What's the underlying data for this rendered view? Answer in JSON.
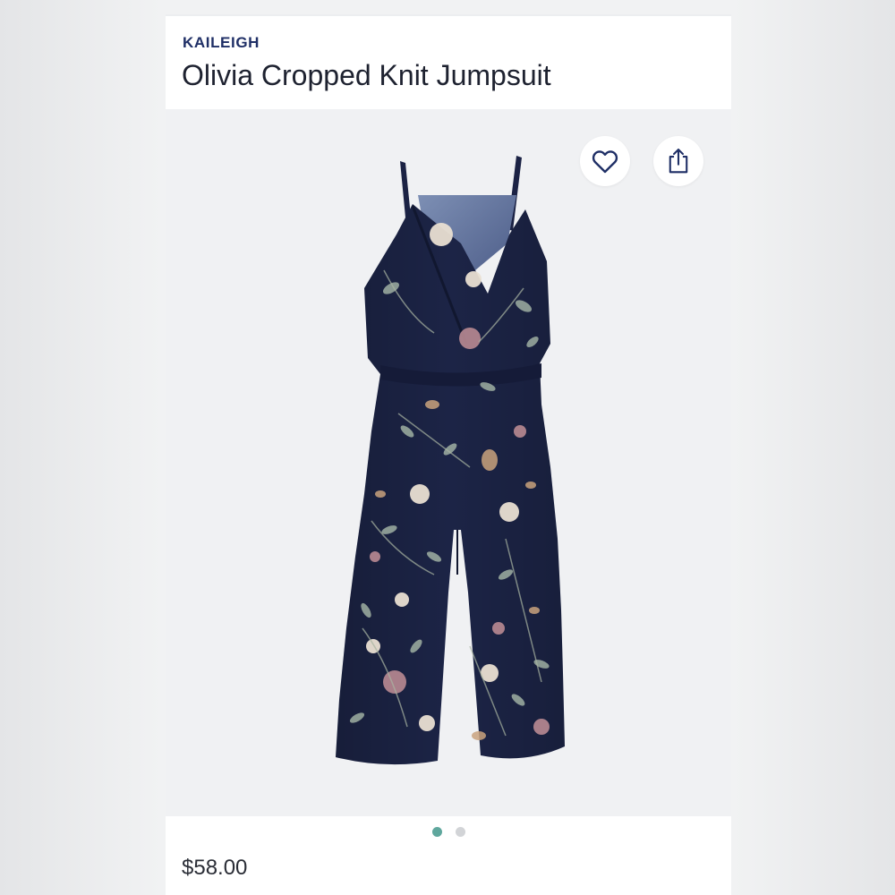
{
  "product": {
    "brand": "KAILEIGH",
    "name": "Olivia Cropped Knit Jumpsuit",
    "price": "$58.00",
    "image_alt": "navy floral cropped knit jumpsuit",
    "image_count": 2,
    "active_image_index": 0
  },
  "actions": {
    "favorite_icon": "heart-outline-icon",
    "share_icon": "share-upload-icon"
  },
  "colors": {
    "brand_text": "#1f2f66",
    "carousel_active": "#5fa79d",
    "carousel_inactive": "#d2d4d7",
    "garment_base": "#1c2446"
  }
}
